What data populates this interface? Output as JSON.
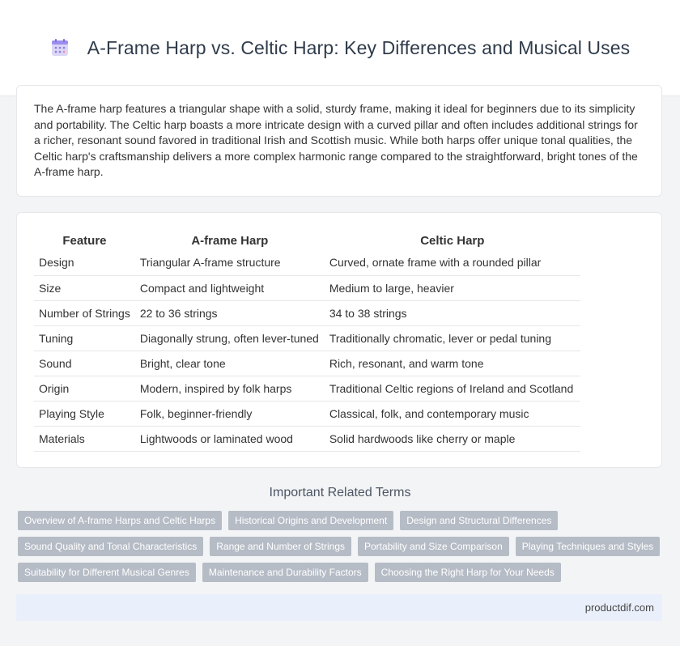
{
  "header": {
    "title": "A-Frame Harp vs. Celtic Harp: Key Differences and Musical Uses",
    "icon": "calendar-icon"
  },
  "intro": {
    "text": "The A-frame harp features a triangular shape with a solid, sturdy frame, making it ideal for beginners due to its simplicity and portability. The Celtic harp boasts a more intricate design with a curved pillar and often includes additional strings for a richer, resonant sound favored in traditional Irish and Scottish music. While both harps offer unique tonal qualities, the Celtic harp's craftsmanship delivers a more complex harmonic range compared to the straightforward, bright tones of the A-frame harp."
  },
  "table": {
    "headers": [
      "Feature",
      "A-frame Harp",
      "Celtic Harp"
    ],
    "rows": [
      [
        "Design",
        "Triangular A-frame structure",
        "Curved, ornate frame with a rounded pillar"
      ],
      [
        "Size",
        "Compact and lightweight",
        "Medium to large, heavier"
      ],
      [
        "Number of Strings",
        "22 to 36 strings",
        "34 to 38 strings"
      ],
      [
        "Tuning",
        "Diagonally strung, often lever-tuned",
        "Traditionally chromatic, lever or pedal tuning"
      ],
      [
        "Sound",
        "Bright, clear tone",
        "Rich, resonant, and warm tone"
      ],
      [
        "Origin",
        "Modern, inspired by folk harps",
        "Traditional Celtic regions of Ireland and Scotland"
      ],
      [
        "Playing Style",
        "Folk, beginner-friendly",
        "Classical, folk, and contemporary music"
      ],
      [
        "Materials",
        "Lightwoods or laminated wood",
        "Solid hardwoods like cherry or maple"
      ]
    ]
  },
  "related": {
    "title": "Important Related Terms",
    "rows": [
      [
        "Overview of A-frame Harps and Celtic Harps",
        "Historical Origins and Development",
        "Design and Structural Differences"
      ],
      [
        "Sound Quality and Tonal Characteristics",
        "Range and Number of Strings",
        "Portability and Size Comparison",
        "Playing Techniques and Styles"
      ],
      [
        "Suitability for Different Musical Genres",
        "Maintenance and Durability Factors",
        "Choosing the Right Harp for Your Needs"
      ]
    ]
  },
  "footer": {
    "site": "productdif.com"
  }
}
